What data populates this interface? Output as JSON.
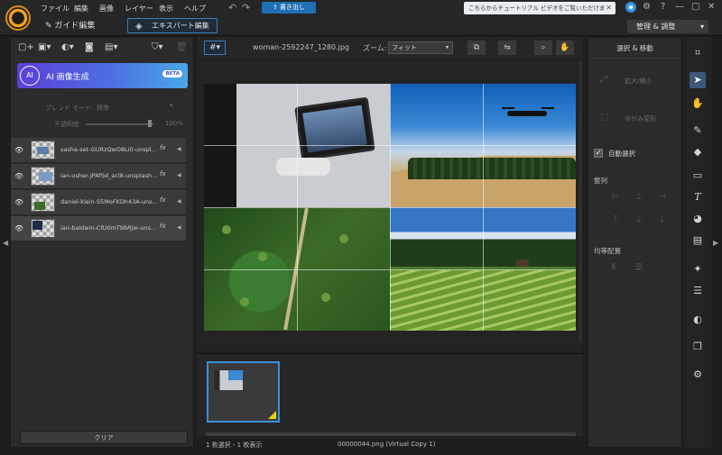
{
  "menu": {
    "items": [
      "ファイル",
      "編集",
      "画像",
      "レイヤー",
      "表示",
      "ヘルプ"
    ],
    "upload_label": "書き出し",
    "tutorial_text": "こちらからチュートリアル ビデオをご覧いただけます...",
    "tutorial_close": "✕",
    "notif_icon_glyph": "◉",
    "settings_icon_glyph": "⚙",
    "help_icon_glyph": "?",
    "window_controls": [
      "—",
      "□",
      "✕"
    ]
  },
  "modebar": {
    "guide_label": "ガイド編集",
    "expert_label": "エキスパート編集",
    "manage_label": "管理 & 調整",
    "manage_arrow": "▾"
  },
  "left_panel": {
    "ai_label": "AI 画像生成",
    "beta_badge": "BETA",
    "ai_icon_text": "AI",
    "blend_label": "ブレンド モード:",
    "blend_value": "標準",
    "opacity_label": "不透明度",
    "opacity_value": "100%",
    "opacity_level": 1.0,
    "layers": [
      {
        "name": "sasha-set-GURzQwO8Li0-unspl...",
        "fx": "fx"
      },
      {
        "name": "ian-usher-JPAfSd_acl8-unsplash...",
        "fx": "fx"
      },
      {
        "name": "daniel-klein-S5MoFKDh43A-uns...",
        "fx": "fx"
      },
      {
        "name": "ian-baldwin-CfU0mT9bRJw-uns...",
        "fx": "fx"
      }
    ],
    "clear_label": "クリア"
  },
  "center": {
    "filename": "woman-2592247_1280.jpg",
    "zoom_label": "ズーム:",
    "zoom_value": "フィット",
    "status_left": "1 枚選択 - 1 枚表示",
    "status_center": "00000044.png (Virtual Copy 1)"
  },
  "right_panel": {
    "title": "選択 & 移動",
    "scale_label": "拡大/縮小",
    "distort_label": "ゆがみ変形",
    "autoselect_label": "自動選択",
    "autoselect_checked": true,
    "align_label": "整列",
    "distribute_label": "均等配置"
  },
  "icons": {
    "undo": "↶",
    "redo": "↷",
    "guide": "✎",
    "expert": "◈",
    "eye": "👁",
    "layer_arrow": "◀",
    "zoom": "⌕",
    "hand": "✋",
    "crop": "⌗",
    "select": "➤",
    "brush": "✎",
    "eraser": "◆",
    "rect": "▭",
    "text": "T",
    "fill": "◕",
    "gradient": "▤",
    "magic": "✦",
    "adjust": "☰",
    "circle": "◐",
    "clone": "❐",
    "gear": "⚙"
  }
}
